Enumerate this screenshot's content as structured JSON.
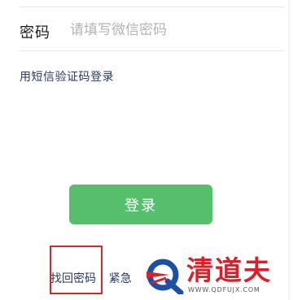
{
  "password_field": {
    "label": "密码",
    "placeholder": "请填写微信密码",
    "value": ""
  },
  "sms_login_link": "用短信验证码登录",
  "login_button": "登录",
  "bottom_links": {
    "find_password": "找回密码",
    "separator": "|",
    "emergency_partial": "紧急"
  },
  "watermark": {
    "title": "清道夫",
    "url": "WWW.QDFUJX.COM",
    "logo_icon": "q-logo-icon"
  },
  "colors": {
    "login_button_bg": "#55bf6d",
    "link_text": "#2a3a5c",
    "highlight_box": "#d4292c",
    "watermark_red": "#d6232b",
    "watermark_blue": "#1e4fa3"
  }
}
